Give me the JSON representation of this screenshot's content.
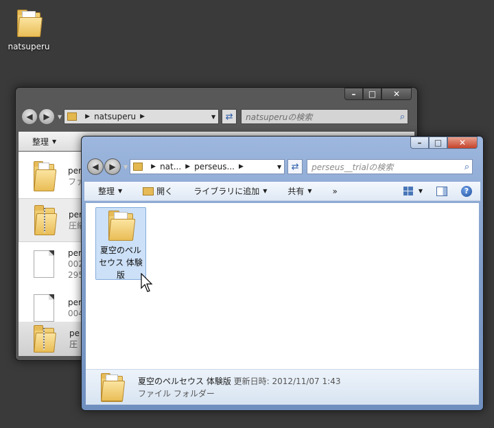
{
  "desktop": {
    "folder_label": "natsuperu"
  },
  "back_window": {
    "address": "natsuperu",
    "search_placeholder": "natsuperuの検索",
    "toolbar": {
      "organize": "整理"
    },
    "rows": [
      {
        "name": "per",
        "sub": "ファ",
        "icon": "folder-icon"
      },
      {
        "name": "per",
        "sub": "圧縮",
        "icon": "zip-folder-icon"
      },
      {
        "name": "per",
        "sub": "002",
        "sub2": "295",
        "icon": "file-icon"
      },
      {
        "name": "per",
        "sub": "004",
        "icon": "file-icon"
      }
    ],
    "details": {
      "name": "pe",
      "sub": "圧"
    }
  },
  "front_window": {
    "breadcrumb": [
      "nat...",
      "perseus..."
    ],
    "search_placeholder": "perseus__trialの検索",
    "toolbar": {
      "organize": "整理",
      "open": "開く",
      "add_to_library": "ライブラリに追加",
      "share": "共有",
      "more": "»"
    },
    "item": {
      "name": "夏空のペルセウス 体験版"
    },
    "details": {
      "name": "夏空のペルセウス 体験版",
      "modified_label": "更新日時:",
      "modified_value": "2012/11/07 1:43",
      "type": "ファイル フォルダー"
    }
  },
  "icons": {
    "back": "back-arrow-icon",
    "forward": "forward-arrow-icon",
    "refresh": "refresh-icon",
    "search": "magnifier-icon",
    "help": "help-icon"
  }
}
